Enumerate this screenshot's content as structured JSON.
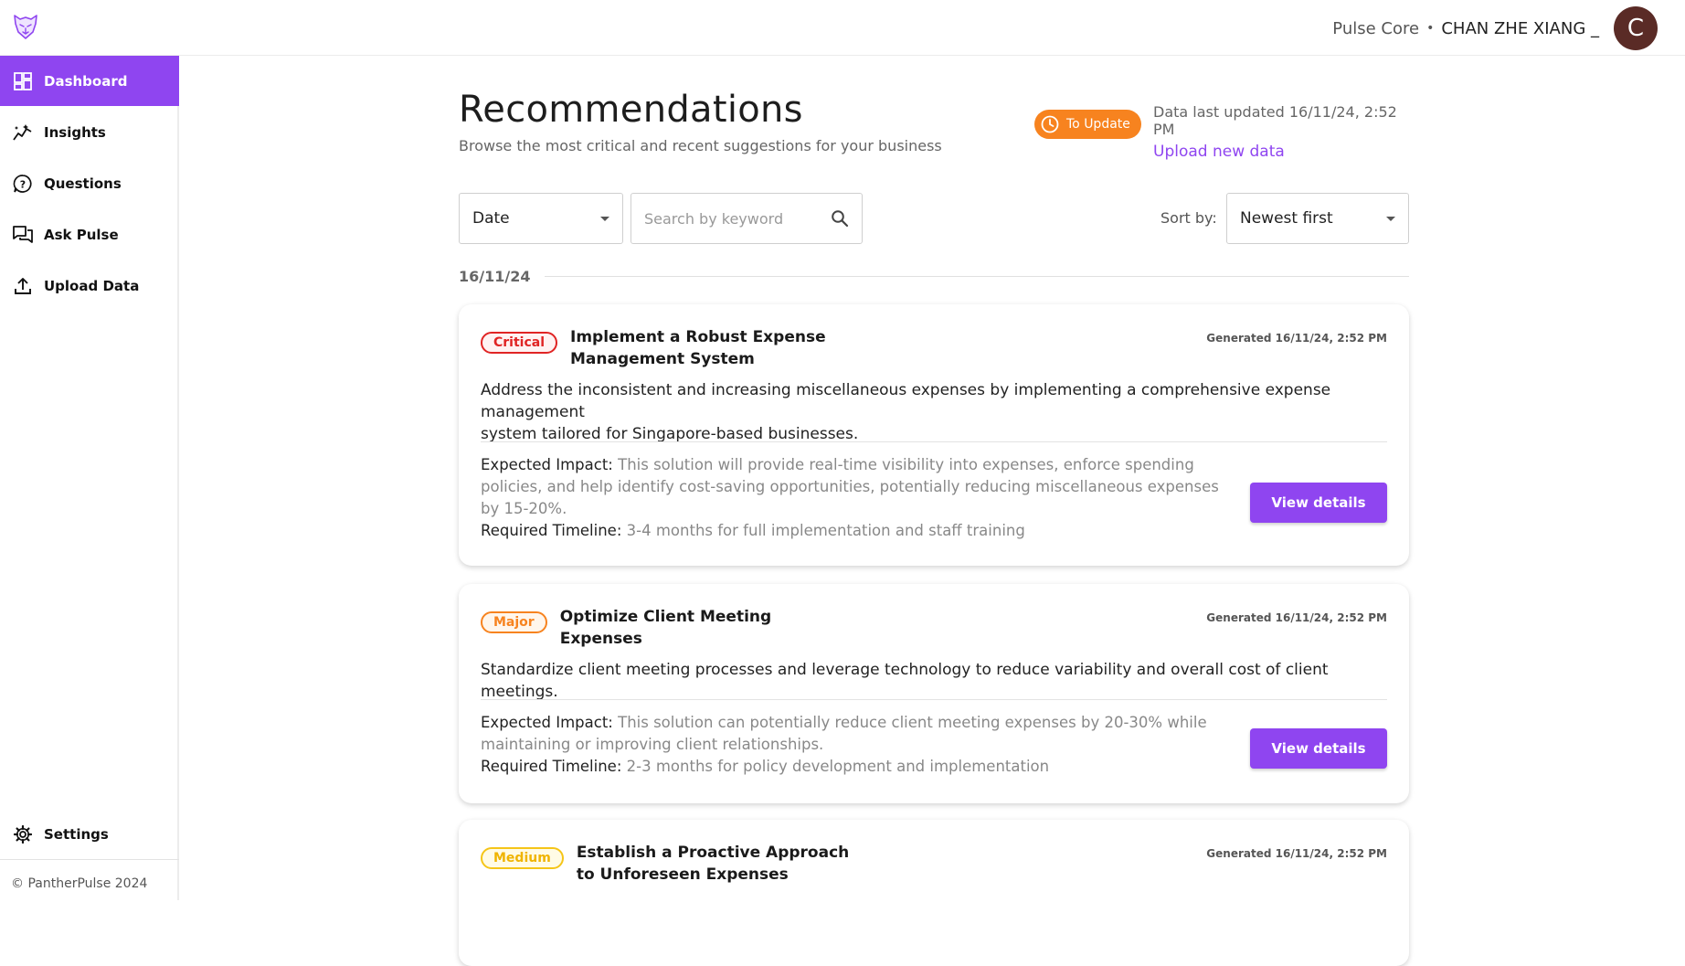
{
  "header": {
    "org": "Pulse Core",
    "separator": "•",
    "user": "CHAN ZHE XIANG _",
    "avatar_letter": "C"
  },
  "sidebar": {
    "items": [
      {
        "label": "Dashboard",
        "icon": "dashboard-icon",
        "active": true
      },
      {
        "label": "Insights",
        "icon": "insights-icon"
      },
      {
        "label": "Questions",
        "icon": "question-icon"
      },
      {
        "label": "Ask Pulse",
        "icon": "chat-icon"
      },
      {
        "label": "Upload Data",
        "icon": "upload-icon"
      }
    ],
    "settings_label": "Settings",
    "copyright": "© PantherPulse 2024"
  },
  "page": {
    "title": "Recommendations",
    "subtitle": "Browse the most critical and recent suggestions for your business",
    "update_badge": "To Update",
    "data_updated": "Data last updated 16/11/24, 2:52 PM",
    "upload_link": "Upload new data"
  },
  "filters": {
    "date_label": "Date",
    "search_placeholder": "Search by keyword",
    "sort_label": "Sort by:",
    "sort_value": "Newest first"
  },
  "group_date": "16/11/24",
  "cards": [
    {
      "severity": "Critical",
      "title_line1": "Implement a Robust Expense",
      "title_line2": "Management System",
      "generated": "Generated 16/11/24, 2:52 PM",
      "desc_line1": "Address the inconsistent and increasing miscellaneous expenses by implementing a comprehensive expense management",
      "desc_line2": "system tailored for Singapore-based businesses.",
      "impact_label": "Expected Impact:",
      "impact_text": "This solution will provide real-time visibility into expenses, enforce spending policies, and help identify cost-saving opportunities, potentially reducing miscellaneous expenses by 15-20%.",
      "timeline_label": "Required Timeline:",
      "timeline_text": "3-4 months for full implementation and staff training",
      "button": "View details"
    },
    {
      "severity": "Major",
      "title_line1": "Optimize Client Meeting",
      "title_line2": "Expenses",
      "generated": "Generated 16/11/24, 2:52 PM",
      "desc_line1": "Standardize client meeting processes and leverage technology to reduce variability and overall cost of client meetings.",
      "impact_label": "Expected Impact:",
      "impact_text": "This solution can potentially reduce client meeting expenses by 20-30% while maintaining or improving client relationships.",
      "timeline_label": "Required Timeline:",
      "timeline_text": "2-3 months for policy development and implementation",
      "button": "View details"
    },
    {
      "severity": "Medium",
      "title_line1": "Establish a Proactive Approach",
      "title_line2": "to Unforeseen Expenses",
      "generated": "Generated 16/11/24, 2:52 PM"
    }
  ],
  "colors": {
    "accent": "#8f45f0",
    "critical": "#e02424",
    "major": "#f7831f",
    "medium": "#f5c518"
  }
}
